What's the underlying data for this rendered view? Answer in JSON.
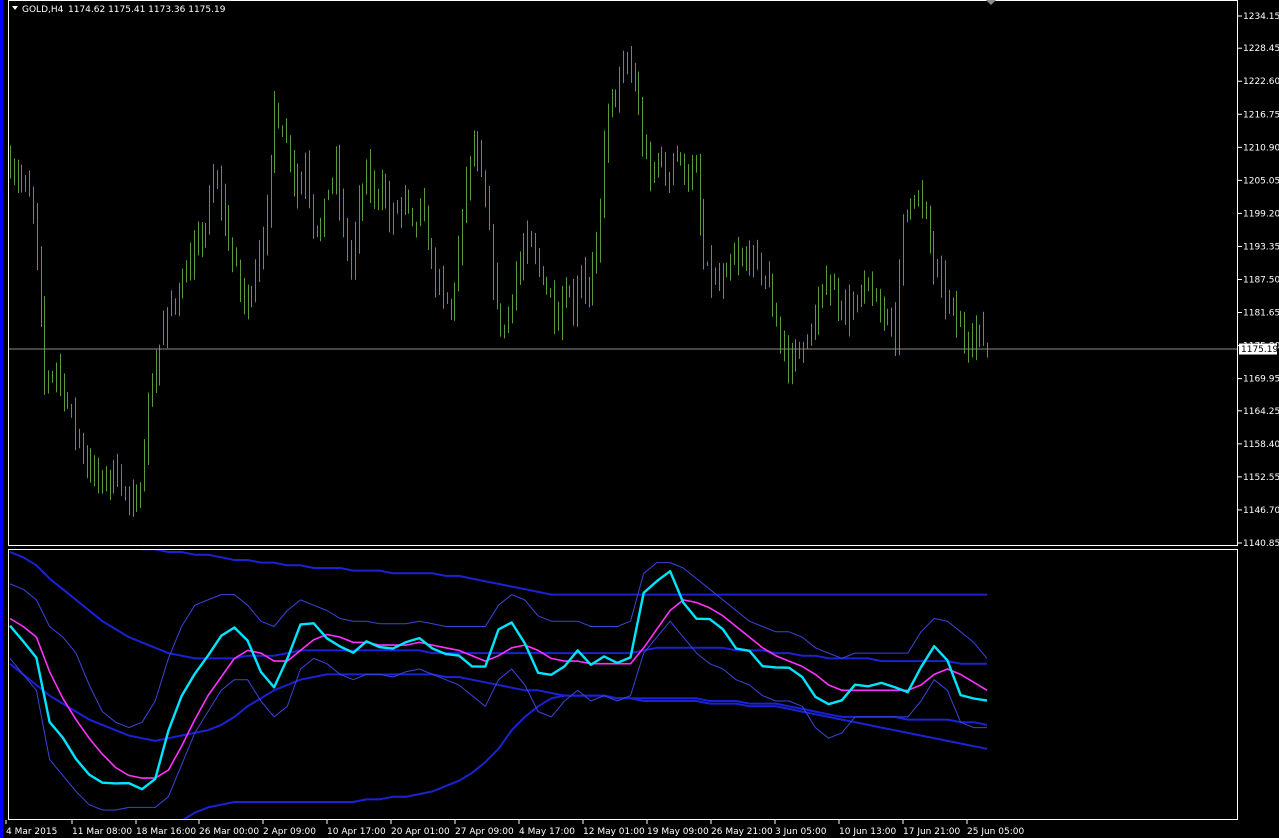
{
  "header": {
    "symbol": "GOLD,H4",
    "ohlc": "1174.62 1175.41 1173.36 1175.19"
  },
  "colors": {
    "background": "#000000",
    "candle": "#5a9a3a",
    "frame": "#ffffff",
    "price_line": "#8c8c8c",
    "osc_main": "#00e5ff",
    "osc_signal": "#ff33ff",
    "env_inner": "#3a45d8",
    "env_outer": "#1a22d6",
    "left_strip": "#0000ff"
  },
  "chart_data": [
    {
      "type": "candlestick",
      "symbol": "GOLD,H4",
      "current_price": 1175.19,
      "current_label": "1175.19",
      "ylim": [
        1140.85,
        1234.15
      ],
      "y_tick_labels": [
        "1234.15",
        "1228.45",
        "1222.60",
        "1216.75",
        "1210.90",
        "1205.05",
        "1199.20",
        "1193.35",
        "1187.50",
        "1181.65",
        "1175.80",
        "1169.95",
        "1164.25",
        "1158.40",
        "1152.55",
        "1146.70",
        "1140.85"
      ],
      "x_tick_labels": [
        "4 Mar 2015",
        "11 Mar 08:00",
        "18 Mar 16:00",
        "26 Mar 00:00",
        "2 Apr 09:00",
        "10 Apr 17:00",
        "20 Apr 01:00",
        "27 Apr 09:00",
        "4 May 17:00",
        "12 May 01:00",
        "19 May 09:00",
        "26 May 21:00",
        "3 Jun 05:00",
        "10 Jun 13:00",
        "17 Jun 21:00",
        "25 Jun 05:00"
      ],
      "close_path": [
        [
          0,
          1208
        ],
        [
          3,
          1205
        ],
        [
          6,
          1200
        ],
        [
          9,
          1170
        ],
        [
          12,
          1172
        ],
        [
          16,
          1163
        ],
        [
          20,
          1155
        ],
        [
          24,
          1151
        ],
        [
          27,
          1154
        ],
        [
          30,
          1150
        ],
        [
          33,
          1146
        ],
        [
          36,
          1165
        ],
        [
          39,
          1176
        ],
        [
          42,
          1183
        ],
        [
          45,
          1187
        ],
        [
          48,
          1192
        ],
        [
          51,
          1197
        ],
        [
          53,
          1205
        ],
        [
          55,
          1202
        ],
        [
          57,
          1194
        ],
        [
          59,
          1189
        ],
        [
          61,
          1183
        ],
        [
          63,
          1186
        ],
        [
          65,
          1193
        ],
        [
          67,
          1198
        ],
        [
          69,
          1218
        ],
        [
          71,
          1214
        ],
        [
          73,
          1210
        ],
        [
          75,
          1203
        ],
        [
          77,
          1208
        ],
        [
          79,
          1198
        ],
        [
          81,
          1196
        ],
        [
          83,
          1204
        ],
        [
          85,
          1207
        ],
        [
          87,
          1196
        ],
        [
          89,
          1190
        ],
        [
          91,
          1200
        ],
        [
          93,
          1206
        ],
        [
          95,
          1202
        ],
        [
          97,
          1205
        ],
        [
          99,
          1198
        ],
        [
          101,
          1200
        ],
        [
          103,
          1202
        ],
        [
          105,
          1196
        ],
        [
          107,
          1200
        ],
        [
          109,
          1194
        ],
        [
          111,
          1188
        ],
        [
          113,
          1184
        ],
        [
          115,
          1182
        ],
        [
          117,
          1192
        ],
        [
          119,
          1205
        ],
        [
          121,
          1211
        ],
        [
          123,
          1205
        ],
        [
          125,
          1195
        ],
        [
          127,
          1182
        ],
        [
          129,
          1178
        ],
        [
          131,
          1186
        ],
        [
          133,
          1190
        ],
        [
          135,
          1194
        ],
        [
          137,
          1191
        ],
        [
          139,
          1188
        ],
        [
          141,
          1184
        ],
        [
          143,
          1181
        ],
        [
          145,
          1186
        ],
        [
          147,
          1183
        ],
        [
          149,
          1189
        ],
        [
          151,
          1185
        ],
        [
          153,
          1192
        ],
        [
          154,
          1200
        ],
        [
          155,
          1212
        ],
        [
          157,
          1220
        ],
        [
          159,
          1222
        ],
        [
          161,
          1226
        ],
        [
          163,
          1222
        ],
        [
          165,
          1212
        ],
        [
          167,
          1205
        ],
        [
          169,
          1210
        ],
        [
          171,
          1205
        ],
        [
          173,
          1210
        ],
        [
          175,
          1208
        ],
        [
          177,
          1206
        ],
        [
          179,
          1206
        ],
        [
          181,
          1190
        ],
        [
          183,
          1188
        ],
        [
          185,
          1186
        ],
        [
          187,
          1188
        ],
        [
          189,
          1191
        ],
        [
          191,
          1190
        ],
        [
          193,
          1192
        ],
        [
          195,
          1190
        ],
        [
          197,
          1188
        ],
        [
          199,
          1183
        ],
        [
          201,
          1177
        ],
        [
          203,
          1172
        ],
        [
          205,
          1175
        ],
        [
          207,
          1175
        ],
        [
          209,
          1178
        ],
        [
          211,
          1182
        ],
        [
          213,
          1188
        ],
        [
          215,
          1185
        ],
        [
          217,
          1183
        ],
        [
          219,
          1182
        ],
        [
          221,
          1183
        ],
        [
          223,
          1186
        ],
        [
          225,
          1185
        ],
        [
          227,
          1180
        ],
        [
          229,
          1183
        ],
        [
          231,
          1178
        ],
        [
          233,
          1197
        ],
        [
          235,
          1203
        ],
        [
          237,
          1202
        ],
        [
          239,
          1198
        ],
        [
          241,
          1190
        ],
        [
          243,
          1186
        ],
        [
          245,
          1183
        ],
        [
          247,
          1180
        ],
        [
          249,
          1177
        ],
        [
          251,
          1178
        ],
        [
          253,
          1178
        ],
        [
          255,
          1175
        ]
      ]
    },
    {
      "type": "line",
      "ylim": [
        0,
        100
      ],
      "series": [
        {
          "role": "main",
          "color": "#00e5ff",
          "values": [
            72,
            66,
            60,
            35,
            30,
            22,
            17,
            14,
            12,
            13,
            11,
            15,
            32,
            45,
            54,
            60,
            68,
            72,
            66,
            56,
            50,
            60,
            72,
            73,
            68,
            64,
            62,
            66,
            64,
            63,
            65,
            67,
            64,
            62,
            60,
            58,
            56,
            70,
            74,
            66,
            55,
            54,
            58,
            62,
            57,
            60,
            58,
            60,
            84,
            88,
            92,
            81,
            76,
            74,
            71,
            64,
            62,
            58,
            57,
            57,
            54,
            46,
            42,
            44,
            50,
            49,
            50,
            49,
            48,
            57,
            65,
            60,
            47,
            45,
            43
          ]
        },
        {
          "role": "signal",
          "color": "#ff33ff",
          "values": [
            75,
            72,
            68,
            55,
            45,
            37,
            30,
            24,
            19,
            16,
            15,
            15,
            18,
            27,
            37,
            46,
            53,
            60,
            63,
            62,
            59,
            59,
            63,
            67,
            69,
            68,
            66,
            66,
            65,
            65,
            65,
            66,
            65,
            64,
            63,
            61,
            59,
            61,
            64,
            65,
            63,
            60,
            59,
            59,
            58,
            58,
            58,
            58,
            64,
            71,
            78,
            82,
            81,
            79,
            76,
            72,
            68,
            64,
            61,
            59,
            57,
            54,
            50,
            48,
            48,
            48,
            48,
            48,
            48,
            50,
            54,
            56,
            54,
            51,
            48
          ]
        },
        {
          "role": "band-upper",
          "color": "#3a45d8",
          "values": [
            88,
            86,
            82,
            72,
            68,
            62,
            50,
            40,
            36,
            34,
            36,
            44,
            60,
            72,
            80,
            82,
            84,
            84,
            80,
            74,
            72,
            78,
            82,
            80,
            78,
            75,
            74,
            74,
            73,
            73,
            73,
            74,
            73,
            72,
            72,
            72,
            72,
            80,
            84,
            82,
            76,
            74,
            74,
            74,
            72,
            72,
            72,
            74,
            92,
            96,
            96,
            94,
            90,
            86,
            82,
            78,
            74,
            72,
            70,
            70,
            68,
            64,
            62,
            60,
            62,
            62,
            62,
            62,
            62,
            70,
            75,
            74,
            70,
            66,
            60
          ]
        },
        {
          "role": "band-lower",
          "color": "#3a45d8",
          "values": [
            60,
            54,
            48,
            22,
            16,
            10,
            5,
            3,
            3,
            4,
            4,
            4,
            8,
            20,
            32,
            40,
            48,
            52,
            52,
            44,
            38,
            42,
            56,
            60,
            58,
            54,
            52,
            54,
            54,
            53,
            55,
            56,
            54,
            52,
            50,
            46,
            42,
            52,
            56,
            50,
            40,
            38,
            44,
            48,
            44,
            46,
            44,
            46,
            62,
            68,
            74,
            68,
            62,
            58,
            56,
            52,
            50,
            46,
            44,
            44,
            42,
            34,
            30,
            32,
            38,
            38,
            38,
            38,
            38,
            44,
            52,
            48,
            36,
            34,
            34
          ]
        },
        {
          "role": "envelope-upper",
          "color": "#1a22d6",
          "values": [
            100,
            98,
            95,
            90,
            86,
            82,
            78,
            74,
            71,
            68,
            66,
            64,
            62,
            61,
            60,
            60,
            60,
            60,
            61,
            61,
            61,
            62,
            63,
            63,
            63,
            63,
            63,
            63,
            63,
            63,
            63,
            63,
            62,
            62,
            62,
            62,
            62,
            62,
            62,
            62,
            62,
            62,
            62,
            62,
            62,
            62,
            62,
            62,
            63,
            64,
            64,
            64,
            64,
            64,
            64,
            63,
            63,
            63,
            62,
            62,
            61,
            61,
            60,
            60,
            60,
            60,
            59,
            59,
            59,
            59,
            59,
            59,
            58,
            58,
            58
          ]
        },
        {
          "role": "envelope-outer-upper",
          "color": "#1a22d6",
          "values": [
            120,
            118,
            115,
            112,
            110,
            107,
            105,
            104,
            103,
            102,
            101,
            101,
            100,
            100,
            99,
            99,
            98,
            97,
            97,
            96,
            96,
            95,
            95,
            94,
            94,
            94,
            93,
            93,
            93,
            92,
            92,
            92,
            92,
            91,
            91,
            90,
            89,
            88,
            87,
            86,
            85,
            84,
            84,
            84,
            84,
            84,
            84,
            84,
            84,
            84,
            84,
            84,
            84,
            84,
            84,
            84,
            84,
            84,
            84,
            84,
            84,
            84,
            84,
            84,
            84,
            84,
            84,
            84,
            84,
            84,
            84,
            84,
            84,
            84,
            84
          ]
        },
        {
          "role": "envelope-lower",
          "color": "#1a22d6",
          "values": [
            58,
            54,
            50,
            46,
            43,
            40,
            37,
            35,
            33,
            31,
            30,
            29,
            30,
            31,
            32,
            33,
            35,
            38,
            42,
            45,
            48,
            50,
            52,
            53,
            54,
            54,
            54,
            54,
            54,
            54,
            54,
            54,
            54,
            53,
            53,
            52,
            51,
            50,
            49,
            48,
            48,
            47,
            46,
            46,
            46,
            46,
            45,
            45,
            45,
            45,
            45,
            45,
            45,
            44,
            44,
            44,
            43,
            43,
            43,
            42,
            41,
            40,
            39,
            38,
            38,
            38,
            38,
            38,
            37,
            37,
            37,
            37,
            36,
            36,
            35
          ]
        },
        {
          "role": "envelope-outer-lower",
          "color": "#1a22d6",
          "values": [
            -10,
            -12,
            -14,
            -16,
            -18,
            -19,
            -19,
            -18,
            -17,
            -14,
            -11,
            -8,
            -5,
            -1,
            2,
            4,
            5,
            6,
            6,
            6,
            6,
            6,
            6,
            6,
            6,
            6,
            6,
            7,
            7,
            8,
            8,
            9,
            10,
            12,
            14,
            17,
            21,
            26,
            33,
            38,
            42,
            45,
            46,
            46,
            46,
            46,
            45,
            45,
            44,
            44,
            44,
            44,
            44,
            43,
            43,
            43,
            42,
            42,
            42,
            41,
            40,
            39,
            38,
            37,
            36,
            35,
            34,
            33,
            32,
            31,
            30,
            29,
            28,
            27,
            26
          ]
        }
      ]
    }
  ]
}
